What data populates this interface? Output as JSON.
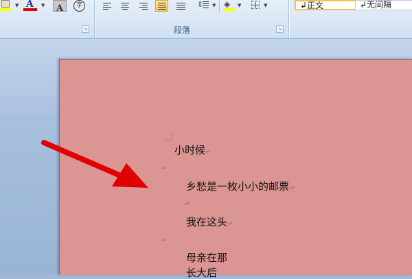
{
  "ribbon": {
    "paragraph_group_label": "段落",
    "font_color_glyph": "A",
    "char_shading_glyph": "A",
    "enclose_char_glyph": "字",
    "styles": [
      {
        "label": "↲正文",
        "selected": true
      },
      {
        "label": "↲无间隔",
        "selected": false
      }
    ],
    "colors": {
      "font_color_bar": "#e00000",
      "highlight_bar": "#ffff00",
      "active_button": "#f9c95f"
    }
  },
  "document": {
    "paragraph_mark": "↵",
    "lines": [
      {
        "text": "小时候"
      },
      {
        "text": ""
      },
      {
        "text": "乡愁是一枚小小的邮票"
      },
      {
        "text": ""
      },
      {
        "text": "我在这头"
      },
      {
        "text": ""
      },
      {
        "text": "母亲在那"
      },
      {
        "text": "长大后"
      }
    ],
    "page_color": "#db9593"
  },
  "annotation": {
    "arrow_color": "#e00000",
    "arrow_icon": "red-arrow-pointer-icon"
  }
}
